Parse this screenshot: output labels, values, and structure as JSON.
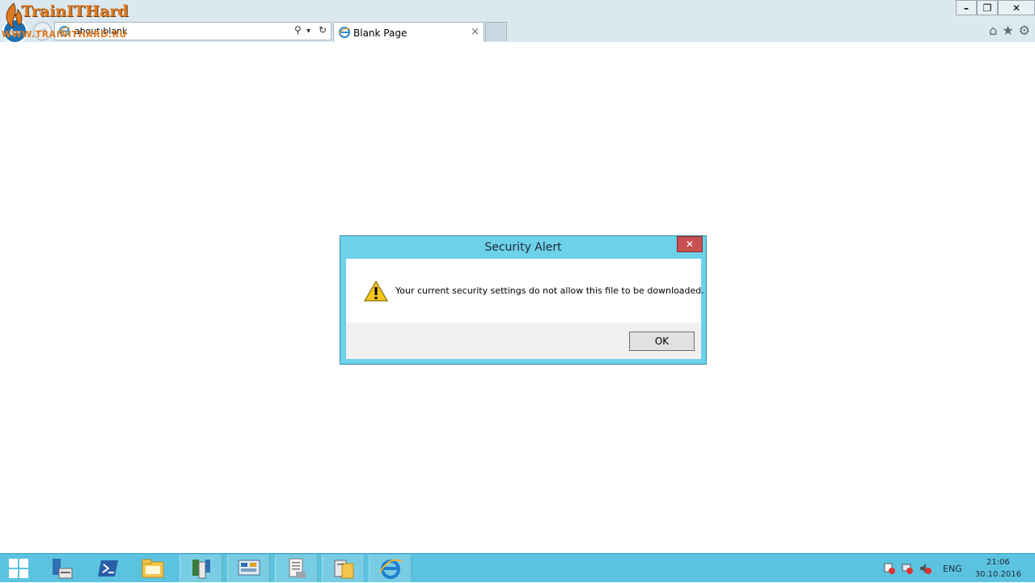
{
  "browser": {
    "address": "about:blank",
    "tab_title": "Blank Page",
    "tab_close": "×",
    "minimize": "–",
    "restore": "❐",
    "close": "✕",
    "home_icon": "⌂",
    "favorites_icon": "★",
    "tools_icon": "⚙",
    "search_icon": "⚲",
    "dropdown_icon": "▾",
    "refresh_icon": "↻",
    "back_icon": "←",
    "forward_icon": "→"
  },
  "watermark": {
    "title": "TrainITHard",
    "url": "WWW.TRAINITHARD.RU"
  },
  "dialog": {
    "title": "Security Alert",
    "close": "✕",
    "message": "Your current security settings do not allow this file to be downloaded.",
    "ok_label": "OK"
  },
  "taskbar": {
    "items": [
      "start",
      "server-manager",
      "powershell",
      "file-explorer",
      "app-4",
      "app-5",
      "app-6",
      "app-7",
      "internet-explorer"
    ],
    "tray": {
      "language": "ENG",
      "time": "21:06",
      "date": "30.10.2016"
    }
  },
  "colors": {
    "accent": "#5bc3e0",
    "dialog_border": "#6dd1ea",
    "close_red": "#c75050",
    "watermark_orange": "#e07a20"
  }
}
